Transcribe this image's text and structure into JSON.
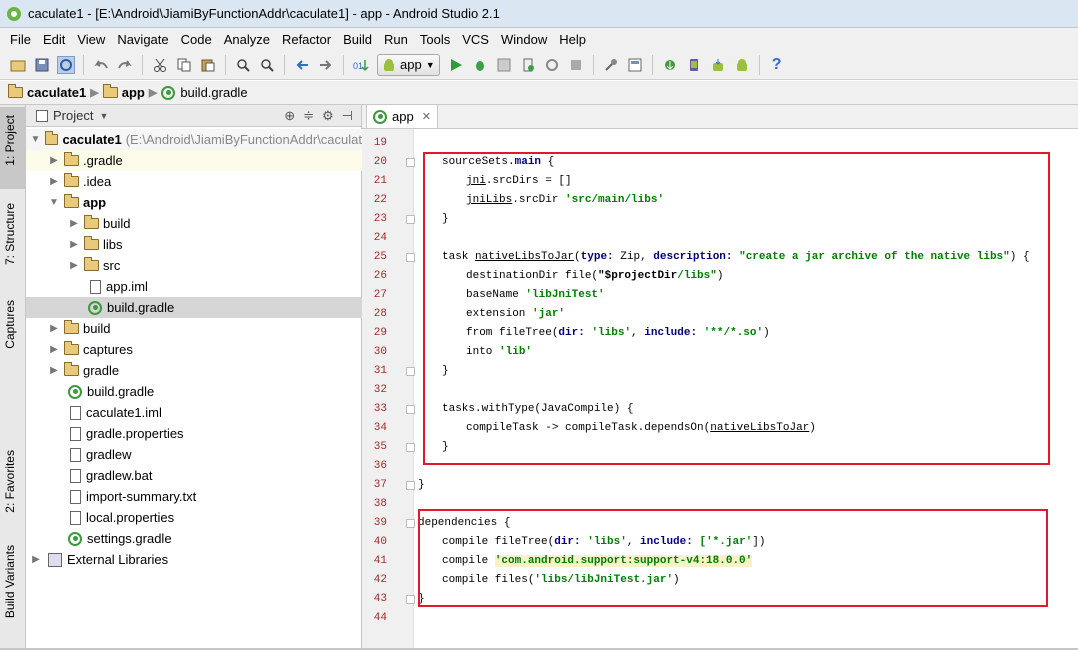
{
  "window": {
    "title": "caculate1 - [E:\\Android\\JiamiByFunctionAddr\\caculate1] - app - Android Studio 2.1"
  },
  "menu": [
    "File",
    "Edit",
    "View",
    "Navigate",
    "Code",
    "Analyze",
    "Refactor",
    "Build",
    "Run",
    "Tools",
    "VCS",
    "Window",
    "Help"
  ],
  "toolbar": {
    "run_config": "app"
  },
  "breadcrumb": [
    "caculate1",
    "app",
    "build.gradle"
  ],
  "left_tabs": [
    "1: Project",
    "7: Structure",
    "Captures",
    "2: Favorites",
    "Build Variants"
  ],
  "project_panel": {
    "header": "Project",
    "tree": [
      {
        "label": "caculate1",
        "suffix": "(E:\\Android\\JiamiByFunctionAddr\\caculat"
      },
      {
        "label": ".gradle"
      },
      {
        "label": ".idea"
      },
      {
        "label": "app"
      },
      {
        "label": "build"
      },
      {
        "label": "libs"
      },
      {
        "label": "src"
      },
      {
        "label": "app.iml"
      },
      {
        "label": "build.gradle"
      },
      {
        "label": "build"
      },
      {
        "label": "captures"
      },
      {
        "label": "gradle"
      },
      {
        "label": "build.gradle"
      },
      {
        "label": "caculate1.iml"
      },
      {
        "label": "gradle.properties"
      },
      {
        "label": "gradlew"
      },
      {
        "label": "gradlew.bat"
      },
      {
        "label": "import-summary.txt"
      },
      {
        "label": "local.properties"
      },
      {
        "label": "settings.gradle"
      },
      {
        "label": "External Libraries"
      }
    ]
  },
  "editor": {
    "tab": "app",
    "line_numbers": [
      "19",
      "20",
      "21",
      "22",
      "23",
      "24",
      "25",
      "26",
      "27",
      "28",
      "29",
      "30",
      "31",
      "32",
      "33",
      "34",
      "35",
      "36",
      "37",
      "38",
      "39",
      "40",
      "41",
      "42",
      "43",
      "44"
    ],
    "lines": {
      "l20a": "sourceSets.",
      "l20b": "main",
      " l20c": " {",
      "l21a": "jni",
      "l21b": ".srcDirs = []",
      "l22a": "jniLibs",
      "l22b": ".srcDir ",
      "l22c": "'src/main/libs'",
      "l23": "}",
      "l25a": "task ",
      "l25b": "nativeLibsToJar",
      "l25c": "(",
      "l25d": "type: ",
      "l25e": "Zip, ",
      "l25f": "description: ",
      "l25g": "\"create a jar archive of the native libs\"",
      "l25h": ") {",
      "l26a": "destinationDir file(",
      "l26b": "\"$projectDir",
      "l26c": "/libs\"",
      "l26d": ")",
      "l27a": "baseName ",
      "l27b": "'libJniTest'",
      "l28a": "extension ",
      "l28b": "'jar'",
      "l29a": "from fileTree(",
      "l29b": "dir: ",
      "l29c": "'libs'",
      "l29d": ", ",
      "l29e": "include: ",
      "l29f": "'**/*.so'",
      "l29g": ")",
      "l30a": "into ",
      "l30b": "'lib'",
      "l31": "}",
      "l33": "tasks.withType(JavaCompile) {",
      "l34a": "compileTask -> compileTask.dependsOn(",
      "l34b": "nativeLibsToJar",
      "l34c": ")",
      "l35": "}",
      "l37": "}",
      "l39": "dependencies {",
      "l40a": "compile fileTree(",
      "l40b": "dir: ",
      "l40c": "'libs'",
      "l40d": ", ",
      "l40e": "include: ",
      "l40f": "['*.jar'",
      "l40g": "])",
      "l41a": "compile ",
      "l41b": "'com.android.support:support-v4:18.0.0'",
      "l42a": "compile files(",
      "l42b": "'libs/libJniTest.jar'",
      "l42c": ")",
      "l43": "}"
    }
  }
}
